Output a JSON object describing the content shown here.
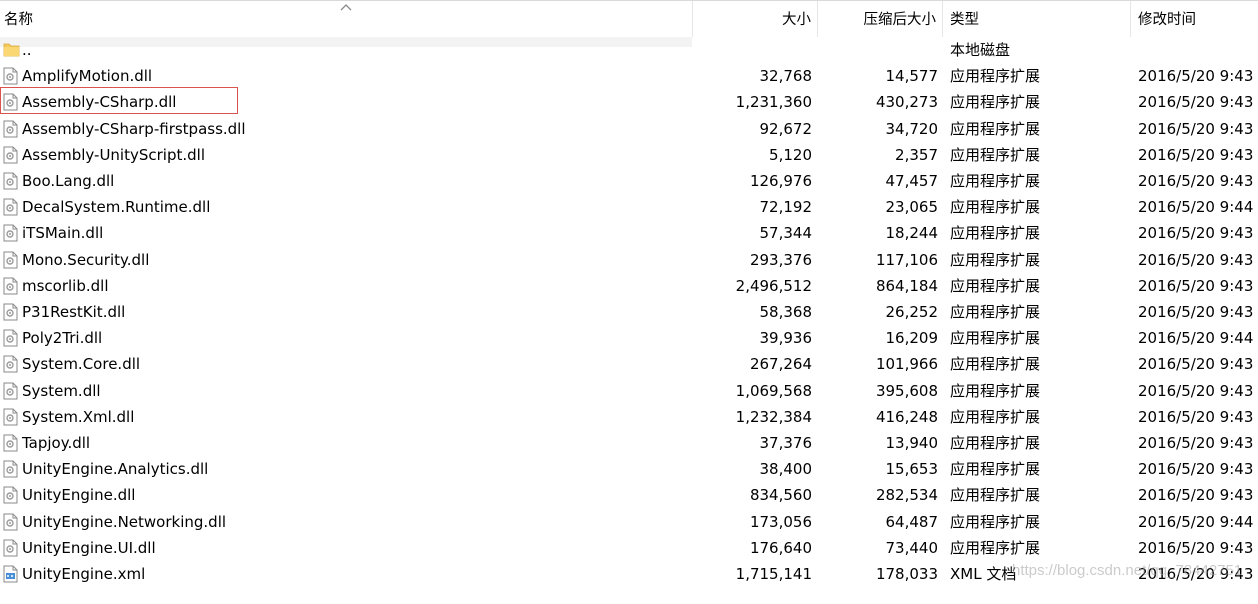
{
  "columns": {
    "name": "名称",
    "size": "大小",
    "compressed": "压缩后大小",
    "type": "类型",
    "modified": "修改时间"
  },
  "rows": [
    {
      "name": "..",
      "size": "",
      "compressed": "",
      "type": "本地磁盘",
      "modified": "",
      "icon": "folder-icon"
    },
    {
      "name": "AmplifyMotion.dll",
      "size": "32,768",
      "compressed": "14,577",
      "type": "应用程序扩展",
      "modified": "2016/5/20 9:43",
      "icon": "dll-file-icon"
    },
    {
      "name": "Assembly-CSharp.dll",
      "size": "1,231,360",
      "compressed": "430,273",
      "type": "应用程序扩展",
      "modified": "2016/5/20 9:43",
      "icon": "dll-file-icon"
    },
    {
      "name": "Assembly-CSharp-firstpass.dll",
      "size": "92,672",
      "compressed": "34,720",
      "type": "应用程序扩展",
      "modified": "2016/5/20 9:43",
      "icon": "dll-file-icon"
    },
    {
      "name": "Assembly-UnityScript.dll",
      "size": "5,120",
      "compressed": "2,357",
      "type": "应用程序扩展",
      "modified": "2016/5/20 9:43",
      "icon": "dll-file-icon"
    },
    {
      "name": "Boo.Lang.dll",
      "size": "126,976",
      "compressed": "47,457",
      "type": "应用程序扩展",
      "modified": "2016/5/20 9:43",
      "icon": "dll-file-icon"
    },
    {
      "name": "DecalSystem.Runtime.dll",
      "size": "72,192",
      "compressed": "23,065",
      "type": "应用程序扩展",
      "modified": "2016/5/20 9:44",
      "icon": "dll-file-icon"
    },
    {
      "name": "iTSMain.dll",
      "size": "57,344",
      "compressed": "18,244",
      "type": "应用程序扩展",
      "modified": "2016/5/20 9:43",
      "icon": "dll-file-icon"
    },
    {
      "name": "Mono.Security.dll",
      "size": "293,376",
      "compressed": "117,106",
      "type": "应用程序扩展",
      "modified": "2016/5/20 9:43",
      "icon": "dll-file-icon"
    },
    {
      "name": "mscorlib.dll",
      "size": "2,496,512",
      "compressed": "864,184",
      "type": "应用程序扩展",
      "modified": "2016/5/20 9:43",
      "icon": "dll-file-icon"
    },
    {
      "name": "P31RestKit.dll",
      "size": "58,368",
      "compressed": "26,252",
      "type": "应用程序扩展",
      "modified": "2016/5/20 9:43",
      "icon": "dll-file-icon"
    },
    {
      "name": "Poly2Tri.dll",
      "size": "39,936",
      "compressed": "16,209",
      "type": "应用程序扩展",
      "modified": "2016/5/20 9:44",
      "icon": "dll-file-icon"
    },
    {
      "name": "System.Core.dll",
      "size": "267,264",
      "compressed": "101,966",
      "type": "应用程序扩展",
      "modified": "2016/5/20 9:43",
      "icon": "dll-file-icon"
    },
    {
      "name": "System.dll",
      "size": "1,069,568",
      "compressed": "395,608",
      "type": "应用程序扩展",
      "modified": "2016/5/20 9:43",
      "icon": "dll-file-icon"
    },
    {
      "name": "System.Xml.dll",
      "size": "1,232,384",
      "compressed": "416,248",
      "type": "应用程序扩展",
      "modified": "2016/5/20 9:43",
      "icon": "dll-file-icon"
    },
    {
      "name": "Tapjoy.dll",
      "size": "37,376",
      "compressed": "13,940",
      "type": "应用程序扩展",
      "modified": "2016/5/20 9:43",
      "icon": "dll-file-icon"
    },
    {
      "name": "UnityEngine.Analytics.dll",
      "size": "38,400",
      "compressed": "15,653",
      "type": "应用程序扩展",
      "modified": "2016/5/20 9:43",
      "icon": "dll-file-icon"
    },
    {
      "name": "UnityEngine.dll",
      "size": "834,560",
      "compressed": "282,534",
      "type": "应用程序扩展",
      "modified": "2016/5/20 9:43",
      "icon": "dll-file-icon"
    },
    {
      "name": "UnityEngine.Networking.dll",
      "size": "173,056",
      "compressed": "64,487",
      "type": "应用程序扩展",
      "modified": "2016/5/20 9:44",
      "icon": "dll-file-icon"
    },
    {
      "name": "UnityEngine.UI.dll",
      "size": "176,640",
      "compressed": "73,440",
      "type": "应用程序扩展",
      "modified": "2016/5/20 9:43",
      "icon": "dll-file-icon"
    },
    {
      "name": "UnityEngine.xml",
      "size": "1,715,141",
      "compressed": "178,033",
      "type": "XML 文档",
      "modified": "2016/5/20 9:43",
      "icon": "xml-file-icon"
    }
  ],
  "watermark": "https://blog.csdn.net/qq_78442751",
  "colors": {
    "highlight_border": "#d9534f",
    "folder": "#f5c85c"
  }
}
